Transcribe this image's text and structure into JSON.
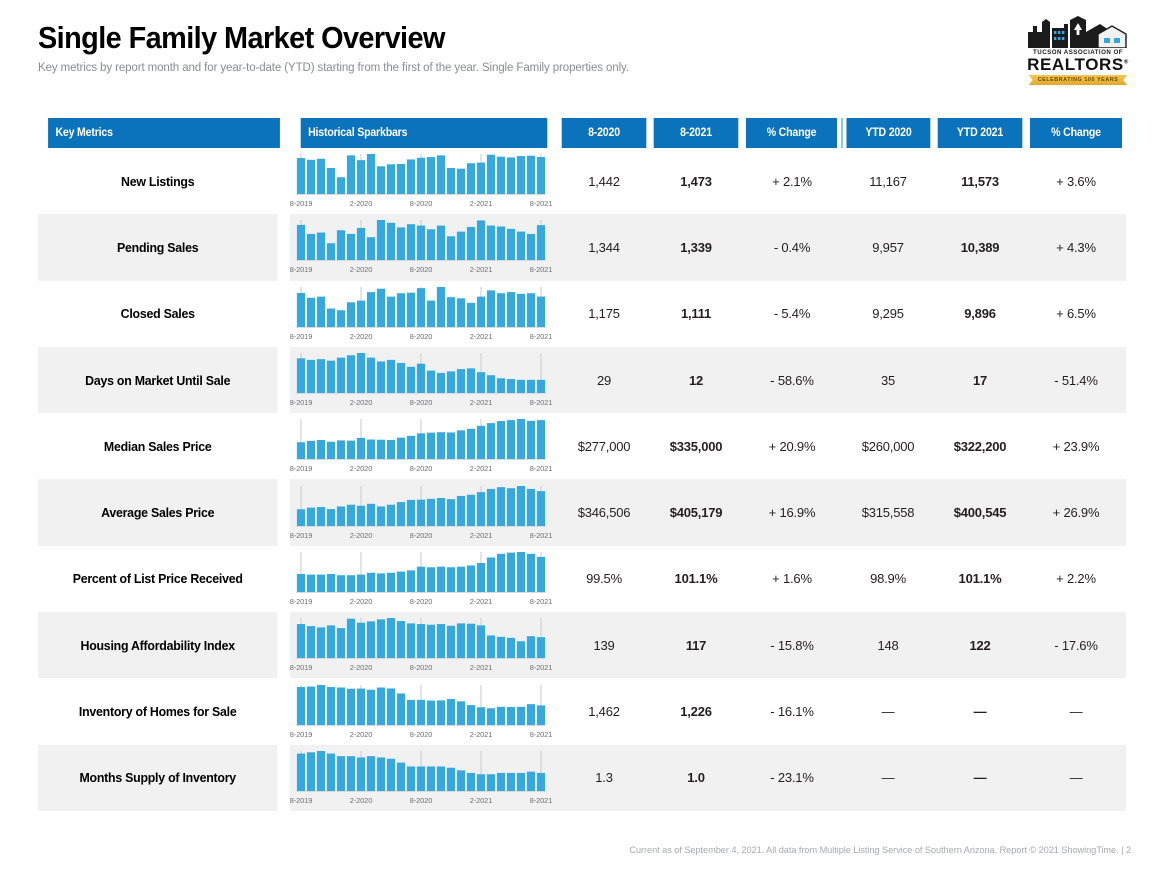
{
  "header": {
    "title": "Single Family Market Overview",
    "subtitle": "Key metrics by report month and for year-to-date (YTD) starting from the first of the year. Single Family properties only."
  },
  "logo": {
    "association": "TUCSON ASSOCIATION OF",
    "name": "REALTORS",
    "registered": "®",
    "ribbon": "CELEBRATING 100 YEARS"
  },
  "colors": {
    "header_blue": "#0b72bc",
    "sparkbar_blue": "#35a8e0",
    "divider_blue": "#8cc8ea",
    "row_alt": "#f1f1f2"
  },
  "table": {
    "columns": [
      "Key Metrics",
      "Historical Sparkbars",
      "8-2020",
      "8-2021",
      "% Change",
      "YTD 2020",
      "YTD 2021",
      "% Change"
    ],
    "sparkbar_axis_labels": [
      "8-2019",
      "2-2020",
      "8-2020",
      "2-2021",
      "8-2021"
    ],
    "rows": [
      {
        "metric": "New Listings",
        "month_prior": "1,442",
        "month_current": "1,473",
        "month_change": "+ 2.1%",
        "ytd_prior": "11,167",
        "ytd_current": "11,573",
        "ytd_change": "+ 3.6%"
      },
      {
        "metric": "Pending Sales",
        "month_prior": "1,344",
        "month_current": "1,339",
        "month_change": "- 0.4%",
        "ytd_prior": "9,957",
        "ytd_current": "10,389",
        "ytd_change": "+ 4.3%"
      },
      {
        "metric": "Closed Sales",
        "month_prior": "1,175",
        "month_current": "1,111",
        "month_change": "- 5.4%",
        "ytd_prior": "9,295",
        "ytd_current": "9,896",
        "ytd_change": "+ 6.5%"
      },
      {
        "metric": "Days on Market Until Sale",
        "month_prior": "29",
        "month_current": "12",
        "month_change": "- 58.6%",
        "ytd_prior": "35",
        "ytd_current": "17",
        "ytd_change": "- 51.4%"
      },
      {
        "metric": "Median Sales Price",
        "month_prior": "$277,000",
        "month_current": "$335,000",
        "month_change": "+ 20.9%",
        "ytd_prior": "$260,000",
        "ytd_current": "$322,200",
        "ytd_change": "+ 23.9%"
      },
      {
        "metric": "Average Sales Price",
        "month_prior": "$346,506",
        "month_current": "$405,179",
        "month_change": "+ 16.9%",
        "ytd_prior": "$315,558",
        "ytd_current": "$400,545",
        "ytd_change": "+ 26.9%"
      },
      {
        "metric": "Percent of List Price Received",
        "month_prior": "99.5%",
        "month_current": "101.1%",
        "month_change": "+ 1.6%",
        "ytd_prior": "98.9%",
        "ytd_current": "101.1%",
        "ytd_change": "+ 2.2%"
      },
      {
        "metric": "Housing Affordability Index",
        "month_prior": "139",
        "month_current": "117",
        "month_change": "- 15.8%",
        "ytd_prior": "148",
        "ytd_current": "122",
        "ytd_change": "- 17.6%"
      },
      {
        "metric": "Inventory of Homes for Sale",
        "month_prior": "1,462",
        "month_current": "1,226",
        "month_change": "- 16.1%",
        "ytd_prior": "—",
        "ytd_current": "—",
        "ytd_change": "—"
      },
      {
        "metric": "Months Supply of Inventory",
        "month_prior": "1.3",
        "month_current": "1.0",
        "month_change": "- 23.1%",
        "ytd_prior": "—",
        "ytd_current": "—",
        "ytd_change": "—"
      }
    ]
  },
  "chart_data": [
    {
      "type": "bar",
      "title": "New Listings",
      "x": [
        "8-2019",
        "9-2019",
        "10-2019",
        "11-2019",
        "12-2019",
        "1-2020",
        "2-2020",
        "3-2020",
        "4-2020",
        "5-2020",
        "6-2020",
        "7-2020",
        "8-2020",
        "9-2020",
        "10-2020",
        "11-2020",
        "12-2020",
        "1-2021",
        "2-2021",
        "3-2021",
        "4-2021",
        "5-2021",
        "6-2021",
        "7-2021",
        "8-2021"
      ],
      "values": [
        1442,
        1390,
        1420,
        1150,
        880,
        1520,
        1380,
        1560,
        1200,
        1260,
        1270,
        1400,
        1450,
        1470,
        1520,
        1150,
        1130,
        1290,
        1310,
        1540,
        1480,
        1460,
        1500,
        1510,
        1473
      ]
    },
    {
      "type": "bar",
      "title": "Pending Sales",
      "x": [
        "8-2019",
        "9-2019",
        "10-2019",
        "11-2019",
        "12-2019",
        "1-2020",
        "2-2020",
        "3-2020",
        "4-2020",
        "5-2020",
        "6-2020",
        "7-2020",
        "8-2020",
        "9-2020",
        "10-2020",
        "11-2020",
        "12-2020",
        "1-2021",
        "2-2021",
        "3-2021",
        "4-2021",
        "5-2021",
        "6-2021",
        "7-2021",
        "8-2021"
      ],
      "values": [
        1344,
        1150,
        1180,
        950,
        1230,
        1150,
        1280,
        1080,
        1450,
        1390,
        1290,
        1360,
        1330,
        1250,
        1330,
        1100,
        1200,
        1300,
        1440,
        1330,
        1310,
        1260,
        1200,
        1150,
        1339
      ]
    },
    {
      "type": "bar",
      "title": "Closed Sales",
      "x": [
        "8-2019",
        "9-2019",
        "10-2019",
        "11-2019",
        "12-2019",
        "1-2020",
        "2-2020",
        "3-2020",
        "4-2020",
        "5-2020",
        "6-2020",
        "7-2020",
        "8-2020",
        "9-2020",
        "10-2020",
        "11-2020",
        "12-2020",
        "1-2021",
        "2-2021",
        "3-2021",
        "4-2021",
        "5-2021",
        "6-2021",
        "7-2021",
        "8-2021"
      ],
      "values": [
        1175,
        1090,
        1110,
        900,
        870,
        1010,
        1040,
        1190,
        1250,
        1110,
        1170,
        1180,
        1260,
        1040,
        1280,
        1100,
        1080,
        1000,
        1110,
        1220,
        1170,
        1190,
        1160,
        1170,
        1111
      ]
    },
    {
      "type": "bar",
      "title": "Days on Market Until Sale",
      "x": [
        "8-2019",
        "9-2019",
        "10-2019",
        "11-2019",
        "12-2019",
        "1-2020",
        "2-2020",
        "3-2020",
        "4-2020",
        "5-2020",
        "6-2020",
        "7-2020",
        "8-2020",
        "9-2020",
        "10-2020",
        "11-2020",
        "12-2020",
        "1-2021",
        "2-2021",
        "3-2021",
        "4-2021",
        "5-2021",
        "6-2021",
        "7-2021",
        "8-2021"
      ],
      "values": [
        40,
        38,
        39,
        37,
        41,
        44,
        47,
        41,
        36,
        38,
        34,
        29,
        33,
        24,
        21,
        23,
        26,
        27,
        22,
        18,
        14,
        13,
        12,
        12,
        12
      ]
    },
    {
      "type": "bar",
      "title": "Median Sales Price",
      "x": [
        "8-2019",
        "9-2019",
        "10-2019",
        "11-2019",
        "12-2019",
        "1-2020",
        "2-2020",
        "3-2020",
        "4-2020",
        "5-2020",
        "6-2020",
        "7-2020",
        "8-2020",
        "9-2020",
        "10-2020",
        "11-2020",
        "12-2020",
        "1-2021",
        "2-2021",
        "3-2021",
        "4-2021",
        "5-2021",
        "6-2021",
        "7-2021",
        "8-2021"
      ],
      "values": [
        238000,
        244000,
        248000,
        240000,
        246000,
        245000,
        257000,
        250000,
        249000,
        248000,
        258000,
        266000,
        277000,
        280000,
        282000,
        281000,
        290000,
        297000,
        310000,
        322000,
        331000,
        335000,
        340000,
        332000,
        335000
      ]
    },
    {
      "type": "bar",
      "title": "Average Sales Price",
      "x": [
        "8-2019",
        "9-2019",
        "10-2019",
        "11-2019",
        "12-2019",
        "1-2020",
        "2-2020",
        "3-2020",
        "4-2020",
        "5-2020",
        "6-2020",
        "7-2020",
        "8-2020",
        "9-2020",
        "10-2020",
        "11-2020",
        "12-2020",
        "1-2021",
        "2-2021",
        "3-2021",
        "4-2021",
        "5-2021",
        "6-2021",
        "7-2021",
        "8-2021"
      ],
      "values": [
        281000,
        292000,
        296000,
        282000,
        300000,
        312000,
        305000,
        318000,
        300000,
        312000,
        330000,
        345000,
        346506,
        352000,
        358000,
        350000,
        372000,
        380000,
        398000,
        420000,
        432000,
        425000,
        440000,
        420000,
        405179
      ]
    },
    {
      "type": "bar",
      "title": "Percent of List Price Received",
      "x": [
        "8-2019",
        "9-2019",
        "10-2019",
        "11-2019",
        "12-2019",
        "1-2020",
        "2-2020",
        "3-2020",
        "4-2020",
        "5-2020",
        "6-2020",
        "7-2020",
        "8-2020",
        "9-2020",
        "10-2020",
        "11-2020",
        "12-2020",
        "1-2021",
        "2-2021",
        "3-2021",
        "4-2021",
        "5-2021",
        "6-2021",
        "7-2021",
        "8-2021"
      ],
      "values": [
        98.3,
        98.2,
        98.2,
        98.3,
        98.1,
        98.1,
        98.2,
        98.5,
        98.4,
        98.5,
        98.7,
        98.9,
        99.5,
        99.4,
        99.5,
        99.4,
        99.5,
        99.7,
        100.1,
        101.0,
        101.6,
        101.8,
        101.9,
        101.6,
        101.1
      ]
    },
    {
      "type": "bar",
      "title": "Housing Affordability Index",
      "x": [
        "8-2019",
        "9-2019",
        "10-2019",
        "11-2019",
        "12-2019",
        "1-2020",
        "2-2020",
        "3-2020",
        "4-2020",
        "5-2020",
        "6-2020",
        "7-2020",
        "8-2020",
        "9-2020",
        "10-2020",
        "11-2020",
        "12-2020",
        "1-2021",
        "2-2021",
        "3-2021",
        "4-2021",
        "5-2021",
        "6-2021",
        "7-2021",
        "8-2021"
      ],
      "values": [
        156,
        150,
        146,
        152,
        144,
        172,
        160,
        164,
        170,
        174,
        165,
        158,
        156,
        154,
        156,
        151,
        158,
        157,
        152,
        122,
        118,
        115,
        105,
        120,
        117
      ]
    },
    {
      "type": "bar",
      "title": "Inventory of Homes for Sale",
      "x": [
        "8-2019",
        "9-2019",
        "10-2019",
        "11-2019",
        "12-2019",
        "1-2020",
        "2-2020",
        "3-2020",
        "4-2020",
        "5-2020",
        "6-2020",
        "7-2020",
        "8-2020",
        "9-2020",
        "10-2020",
        "11-2020",
        "12-2020",
        "1-2021",
        "2-2021",
        "3-2021",
        "4-2021",
        "5-2021",
        "6-2021",
        "7-2021",
        "8-2021"
      ],
      "values": [
        3050,
        3080,
        3180,
        3050,
        3020,
        2940,
        2950,
        2880,
        3020,
        2960,
        2640,
        2230,
        2230,
        2190,
        2200,
        2290,
        2140,
        1900,
        1760,
        1700,
        1790,
        1780,
        1790,
        1960,
        1880
      ]
    },
    {
      "type": "bar",
      "title": "Months Supply of Inventory",
      "x": [
        "8-2019",
        "9-2019",
        "10-2019",
        "11-2019",
        "12-2019",
        "1-2020",
        "2-2020",
        "3-2020",
        "4-2020",
        "5-2020",
        "6-2020",
        "7-2020",
        "8-2020",
        "9-2020",
        "10-2020",
        "11-2020",
        "12-2020",
        "1-2021",
        "2-2021",
        "3-2021",
        "4-2021",
        "5-2021",
        "6-2021",
        "7-2021",
        "8-2021"
      ],
      "values": [
        2.6,
        2.7,
        2.8,
        2.6,
        2.4,
        2.4,
        2.3,
        2.4,
        2.3,
        2.2,
        1.9,
        1.6,
        1.6,
        1.6,
        1.6,
        1.5,
        1.3,
        1.1,
        1.0,
        1.0,
        1.1,
        1.1,
        1.1,
        1.2,
        1.1
      ]
    }
  ],
  "footer": {
    "text": "Current as of September 4, 2021. All data from Multiple Listing Service of Southern Arizona. Report © 2021 ShowingTime.  |  2"
  }
}
